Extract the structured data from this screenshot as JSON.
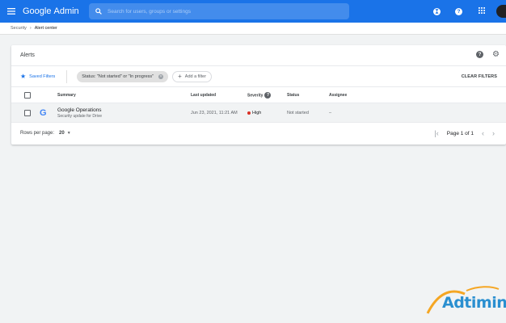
{
  "appbar": {
    "brand_google": "Google",
    "brand_admin": "Admin",
    "search_placeholder": "Search for users, groups or settings",
    "support_label": "?",
    "colors": {
      "brand_blue": "#1a73e8"
    }
  },
  "breadcrumb": {
    "parent": "Security",
    "separator": "›",
    "current": "Alert center"
  },
  "alerts_card": {
    "title": "Alerts",
    "help_label": "?",
    "saved_filters": "Saved Filters",
    "filter_chip": "Status: \"Not started\" or \"In progress\"",
    "add_filter": "Add a filter",
    "clear_filters": "CLEAR FILTERS"
  },
  "table": {
    "columns": [
      "Summary",
      "Last updated",
      "Severity",
      "Status",
      "Assignee"
    ],
    "severity_help": "?",
    "rows": [
      {
        "icon": "google-g-icon",
        "title": "Google Operations",
        "subtitle": "Security update for Drive",
        "last_updated": "Jun 23, 2021, 11:21 AM",
        "severity": "High",
        "severity_color": "#d93025",
        "status": "Not started",
        "assignee": "–"
      }
    ]
  },
  "footer": {
    "rows_per_page_label": "Rows per page:",
    "rows_per_page_value": "20",
    "page_label": "Page 1 of 1"
  },
  "watermark": {
    "text": "Adtimin"
  }
}
